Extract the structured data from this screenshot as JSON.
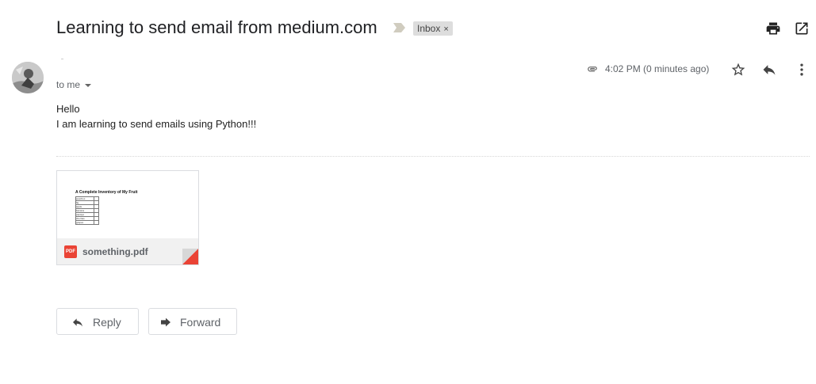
{
  "email": {
    "subject": "Learning to send email from medium.com",
    "label": "Inbox",
    "label_close": "×",
    "recipient_text": "to me",
    "time": "4:02 PM (0 minutes ago)",
    "body_lines": [
      "Hello",
      "I am learning to send emails using Python!!!"
    ]
  },
  "attachment": {
    "file_name": "something.pdf",
    "file_type_badge": "PDF",
    "preview_title": "A Complete Inventory of My Fruit",
    "preview_rows": [
      "peaches",
      "fig",
      "apple",
      "banana",
      "papaya",
      "cherries",
      "grapes"
    ]
  },
  "actions": {
    "reply_label": "Reply",
    "forward_label": "Forward"
  },
  "icons": {
    "print": "print-icon",
    "open_new_window": "open-in-new-window-icon",
    "attachment": "paperclip-icon",
    "star": "star-icon",
    "reply": "reply-icon",
    "more": "more-vertical-icon",
    "label_importance": "importance-marker-icon"
  },
  "colors": {
    "pdf_red": "#ea4335",
    "text_primary": "#202124",
    "text_secondary": "#5f6368",
    "chip_bg": "#dddddd"
  }
}
